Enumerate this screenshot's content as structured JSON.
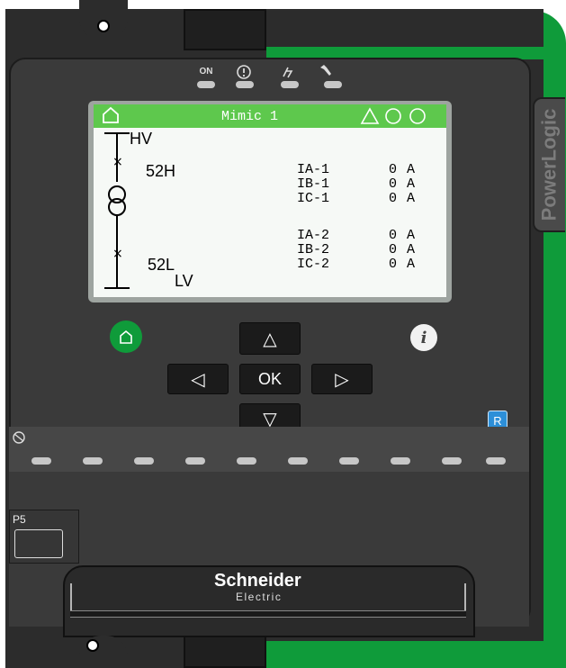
{
  "device": {
    "brand_side_label": "PowerLogic",
    "maker_logo": "Schneider",
    "maker_logo_sub": "Electric",
    "port_label": "P5"
  },
  "leds": [
    {
      "name": "on",
      "symbol": "ON"
    },
    {
      "name": "alarm",
      "symbol": "(!)"
    },
    {
      "name": "trip",
      "symbol": "⚡"
    },
    {
      "name": "maintenance",
      "symbol": "🔧"
    }
  ],
  "screen": {
    "title": "Mimic 1",
    "single_line": {
      "hv_label": "HV",
      "lv_label": "LV",
      "breaker_high": "52H",
      "breaker_low": "52L"
    },
    "readings": [
      {
        "label": "IA-1",
        "value": "0",
        "unit": "A"
      },
      {
        "label": "IB-1",
        "value": "0",
        "unit": "A"
      },
      {
        "label": "IC-1",
        "value": "0",
        "unit": "A"
      },
      {
        "label": "IA-2",
        "value": "0",
        "unit": "A"
      },
      {
        "label": "IB-2",
        "value": "0",
        "unit": "A"
      },
      {
        "label": "IC-2",
        "value": "0",
        "unit": "A"
      }
    ]
  },
  "keypad": {
    "ok_label": "OK",
    "up": "△",
    "down": "▽",
    "left": "◁",
    "right": "▷",
    "info": "i",
    "reset": "R"
  },
  "colors": {
    "accent_green": "#0f9b3a",
    "lcd_header": "#5ec84d",
    "reset_blue": "#2d8fd8"
  }
}
